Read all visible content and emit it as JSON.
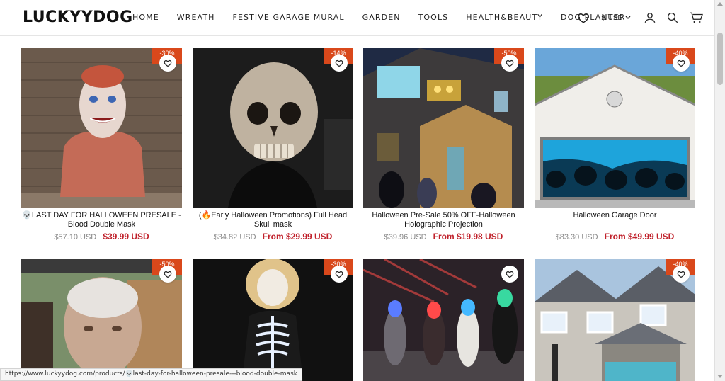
{
  "header": {
    "logo": "LUCKYYDOG",
    "nav": [
      "HOME",
      "WREATH",
      "FESTIVE GARAGE MURAL",
      "GARDEN",
      "TOOLS",
      "HEALTH&BEAUTY",
      "DOG PLANTER"
    ],
    "currency": "$ USD"
  },
  "products_row1": [
    {
      "badge": "-30%",
      "title": "💀LAST DAY FOR HALLOWEEN PRESALE - Blood Double Mask",
      "old_price": "$57.10 USD",
      "new_price": "$39.99 USD"
    },
    {
      "badge": "-14%",
      "title": "(🔥Early Halloween Promotions) Full Head Skull mask",
      "old_price": "$34.82 USD",
      "new_price": "From $29.99 USD"
    },
    {
      "badge": "-50%",
      "title": "Halloween Pre-Sale 50% OFF-Halloween Holographic Projection",
      "old_price": "$39.96 USD",
      "new_price": "From $19.98 USD"
    },
    {
      "badge": "-40%",
      "title": "Halloween Garage Door",
      "old_price": "$83.30 USD",
      "new_price": "From $49.99 USD"
    }
  ],
  "products_row2": [
    {
      "badge": "-50%"
    },
    {
      "badge": "-30%"
    },
    {
      "badge": ""
    },
    {
      "badge": "-40%"
    }
  ],
  "status_url": "https://www.luckyydog.com/products/💀last-day-for-halloween-presale---blood-double-mask"
}
